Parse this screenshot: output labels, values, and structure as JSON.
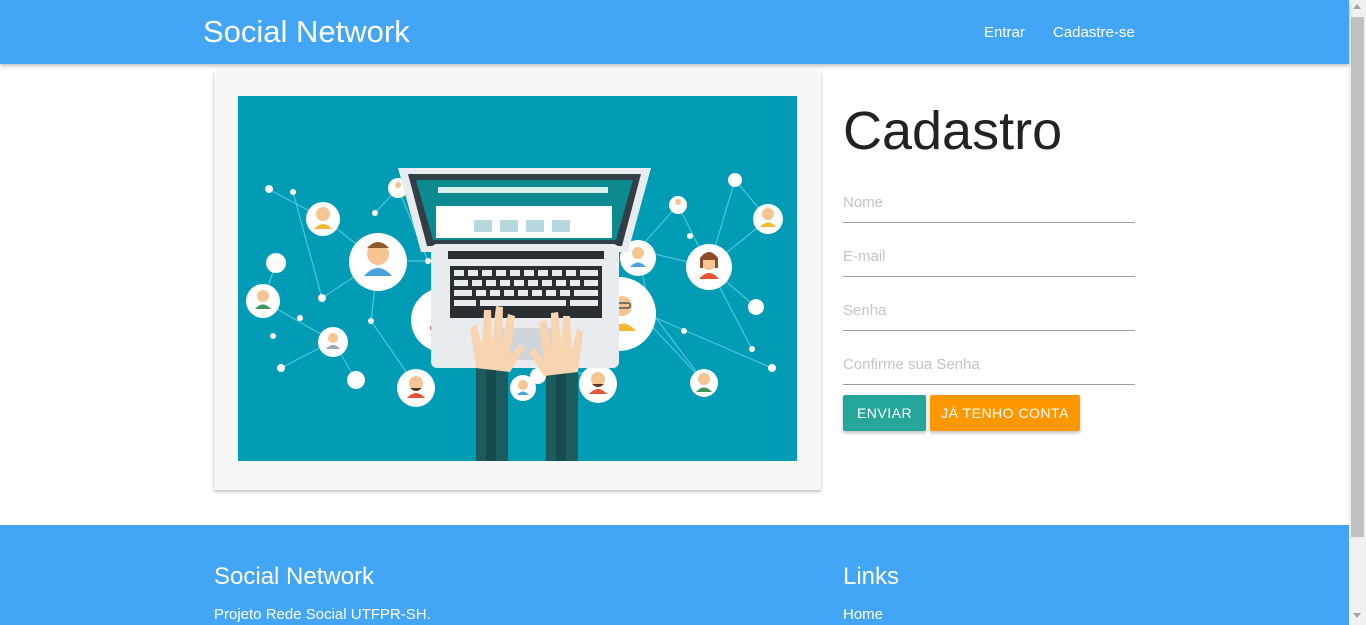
{
  "navbar": {
    "brand": "Social Network",
    "links": [
      "Entrar",
      "Cadastre-se"
    ],
    "color": "#42a5f5"
  },
  "illustration": {
    "description_icon": "social-network-laptop-illustration",
    "background_color": "#009bb5"
  },
  "form": {
    "title": "Cadastro",
    "fields": [
      {
        "placeholder": "Nome",
        "value": ""
      },
      {
        "placeholder": "E-mail",
        "value": ""
      },
      {
        "placeholder": "Senha",
        "value": ""
      },
      {
        "placeholder": "Confirme sua Senha",
        "value": ""
      }
    ],
    "submit_label": "Enviar",
    "have_account_label": "Já tenho conta",
    "submit_color": "#26a69a",
    "have_account_color": "#ff9800"
  },
  "footer": {
    "title": "Social Network",
    "text": "Projeto Rede Social UTFPR-SH.",
    "links_title": "Links",
    "links": [
      "Home"
    ]
  }
}
